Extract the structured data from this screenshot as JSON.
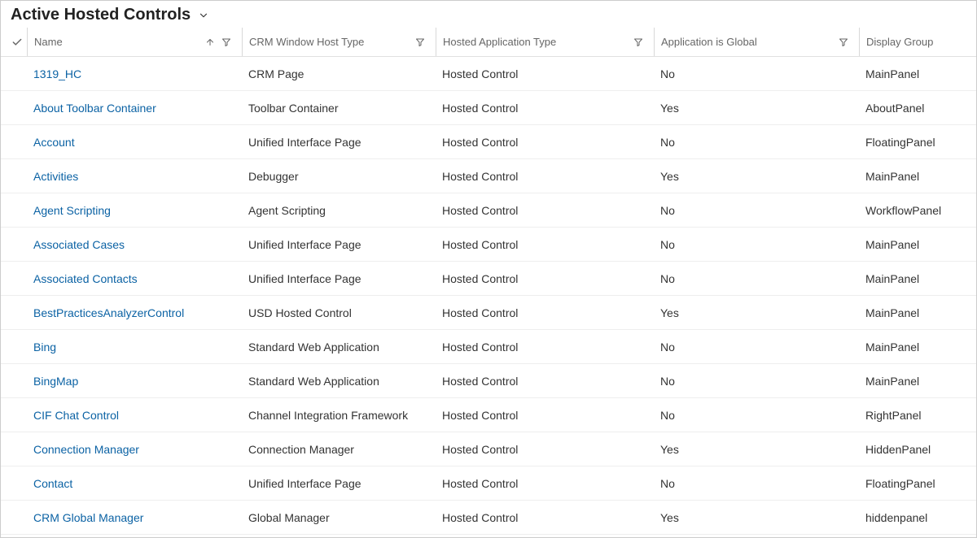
{
  "view": {
    "title": "Active Hosted Controls"
  },
  "columns": {
    "name": "Name",
    "crm_window_host_type": "CRM Window Host Type",
    "hosted_application_type": "Hosted Application Type",
    "application_is_global": "Application is Global",
    "display_group": "Display Group"
  },
  "rows": [
    {
      "name": "1319_HC",
      "crm": "CRM Page",
      "hosted": "Hosted Control",
      "global": "No",
      "display": "MainPanel"
    },
    {
      "name": "About Toolbar Container",
      "crm": "Toolbar Container",
      "hosted": "Hosted Control",
      "global": "Yes",
      "display": "AboutPanel"
    },
    {
      "name": "Account",
      "crm": "Unified Interface Page",
      "hosted": "Hosted Control",
      "global": "No",
      "display": "FloatingPanel"
    },
    {
      "name": "Activities",
      "crm": "Debugger",
      "hosted": "Hosted Control",
      "global": "Yes",
      "display": "MainPanel"
    },
    {
      "name": "Agent Scripting",
      "crm": "Agent Scripting",
      "hosted": "Hosted Control",
      "global": "No",
      "display": "WorkflowPanel"
    },
    {
      "name": "Associated Cases",
      "crm": "Unified Interface Page",
      "hosted": "Hosted Control",
      "global": "No",
      "display": "MainPanel"
    },
    {
      "name": "Associated Contacts",
      "crm": "Unified Interface Page",
      "hosted": "Hosted Control",
      "global": "No",
      "display": "MainPanel"
    },
    {
      "name": "BestPracticesAnalyzerControl",
      "crm": "USD Hosted Control",
      "hosted": "Hosted Control",
      "global": "Yes",
      "display": "MainPanel"
    },
    {
      "name": "Bing",
      "crm": "Standard Web Application",
      "hosted": "Hosted Control",
      "global": "No",
      "display": "MainPanel"
    },
    {
      "name": "BingMap",
      "crm": "Standard Web Application",
      "hosted": "Hosted Control",
      "global": "No",
      "display": "MainPanel"
    },
    {
      "name": "CIF Chat Control",
      "crm": "Channel Integration Framework",
      "hosted": "Hosted Control",
      "global": "No",
      "display": "RightPanel"
    },
    {
      "name": "Connection Manager",
      "crm": "Connection Manager",
      "hosted": "Hosted Control",
      "global": "Yes",
      "display": "HiddenPanel"
    },
    {
      "name": "Contact",
      "crm": "Unified Interface Page",
      "hosted": "Hosted Control",
      "global": "No",
      "display": "FloatingPanel"
    },
    {
      "name": "CRM Global Manager",
      "crm": "Global Manager",
      "hosted": "Hosted Control",
      "global": "Yes",
      "display": "hiddenpanel"
    }
  ]
}
